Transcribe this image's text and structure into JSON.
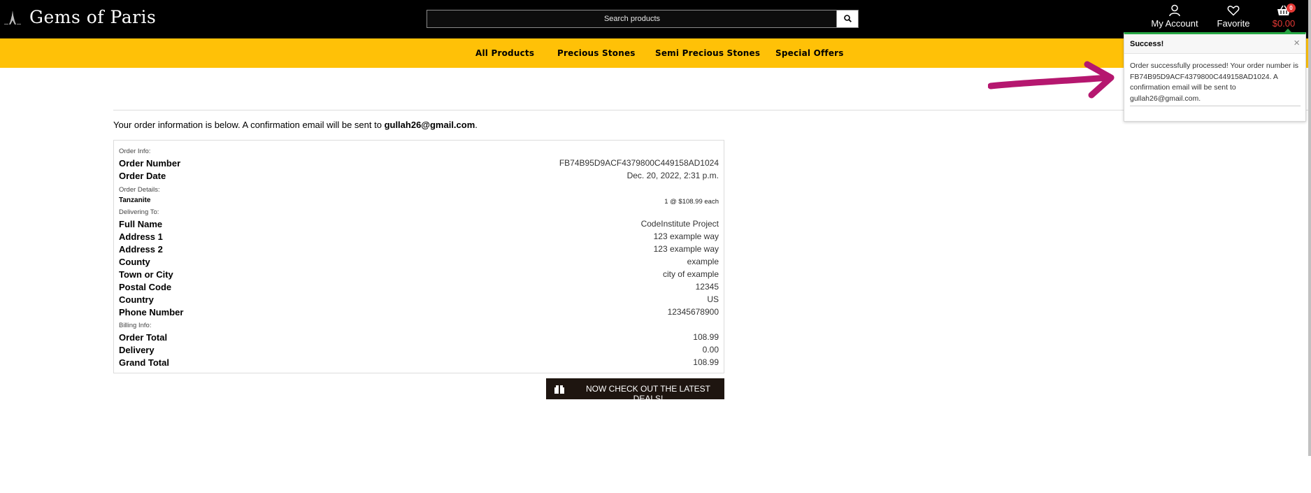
{
  "header": {
    "brand": "Gems of Paris",
    "search_placeholder": "Search products",
    "account_label": "My Account",
    "favorite_label": "Favorite",
    "cart_total": "$0.00",
    "cart_count": "0"
  },
  "nav": {
    "items": [
      "All Products",
      "Precious Stones",
      "Semi Precious Stones",
      "Special Offers"
    ]
  },
  "intro": {
    "text": "Your order information is below. A confirmation email will be sent to ",
    "email": "gullah26@gmail.com",
    "end": "."
  },
  "order": {
    "order_info_label": "Order Info:",
    "order_number_label": "Order Number",
    "order_number": "FB74B95D9ACF4379800C449158AD1024",
    "order_date_label": "Order Date",
    "order_date": "Dec. 20, 2022, 2:31 p.m.",
    "order_details_label": "Order Details:",
    "item_name": "Tanzanite",
    "item_qty_price": "1 @ $108.99 each",
    "delivering_label": "Delivering To:",
    "full_name_label": "Full Name",
    "full_name": "CodeInstitute Project",
    "address1_label": "Address 1",
    "address1": "123 example way",
    "address2_label": "Address 2",
    "address2": "123 example way",
    "county_label": "County",
    "county": "example",
    "town_label": "Town or City",
    "town": "city of example",
    "postal_label": "Postal Code",
    "postal": "12345",
    "country_label": "Country",
    "country": "US",
    "phone_label": "Phone Number",
    "phone": "12345678900",
    "billing_label": "Billing Info:",
    "order_total_label": "Order Total",
    "order_total": "108.99",
    "delivery_label": "Delivery",
    "delivery": "0.00",
    "grand_total_label": "Grand Total",
    "grand_total": "108.99"
  },
  "deals_button": "Now check out the latest deals!",
  "toast": {
    "title": "Success!",
    "close": "×",
    "message": "Order successfully processed! Your order number is FB74B95D9ACF4379800C449158AD1024. A confirmation email will be sent to gullah26@gmail.com."
  },
  "colors": {
    "topbar": "#000000",
    "nav_bar": "#ffc107",
    "cart_accent": "#e53935",
    "toast_accent": "#28a745",
    "annotation_arrow": "#b5176f",
    "deals_button": "#1e1510"
  }
}
